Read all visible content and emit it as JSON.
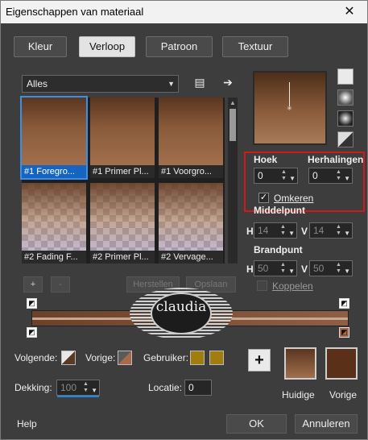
{
  "window": {
    "title": "Eigenschappen van materiaal",
    "close_glyph": "✕"
  },
  "tabs": [
    {
      "label": "Kleur",
      "active": false
    },
    {
      "label": "Verloop",
      "active": true
    },
    {
      "label": "Patroon",
      "active": false
    },
    {
      "label": "Textuur",
      "active": false
    }
  ],
  "library": {
    "category": "Alles",
    "items": [
      {
        "label": "#1 Foregro...",
        "swatch": "brown",
        "selected": true
      },
      {
        "label": "#1 Primer Pl...",
        "swatch": "brown",
        "selected": false
      },
      {
        "label": "#1 Voorgro...",
        "swatch": "brown",
        "selected": false
      },
      {
        "label": "#2 Fading F...",
        "swatch": "fade",
        "selected": false
      },
      {
        "label": "#2 Primer Pl...",
        "swatch": "fade",
        "selected": false
      },
      {
        "label": "#2 Vervage...",
        "swatch": "fade",
        "selected": false
      }
    ],
    "add_label": "+",
    "remove_label": "-",
    "reset_label": "Herstellen",
    "save_label": "Opslaan"
  },
  "properties": {
    "angle_label": "Hoek",
    "angle_value": "0",
    "repeats_label": "Herhalingen",
    "repeats_value": "0",
    "invert_label": "Omkeren",
    "invert_checked": true,
    "center_label": "Middelpunt",
    "center_h_label": "H",
    "center_h_value": "14",
    "center_v_label": "V",
    "center_v_value": "14",
    "focal_label": "Brandpunt",
    "focal_h_label": "H",
    "focal_h_value": "50",
    "focal_v_label": "V",
    "focal_v_value": "50",
    "link_label": "Koppelen",
    "link_checked": false
  },
  "watermark": {
    "text": "claudia"
  },
  "bottom": {
    "foreground_label": "Volgende:",
    "background_label": "Vorige:",
    "user_label": "Gebruiker:",
    "opacity_label": "Dekking:",
    "opacity_value": "100",
    "location_label": "Locatie:",
    "location_value": "0",
    "current_label": "Huidige",
    "previous_label": "Vorige",
    "add_glyph": "+"
  },
  "footer": {
    "help_label": "Help",
    "ok_label": "OK",
    "cancel_label": "Annuleren"
  },
  "colors": {
    "accent": "#1e88e5",
    "highlight_border": "#d01a1a",
    "gradient_start": "#5a3620",
    "gradient_end": "#a16f4c"
  }
}
